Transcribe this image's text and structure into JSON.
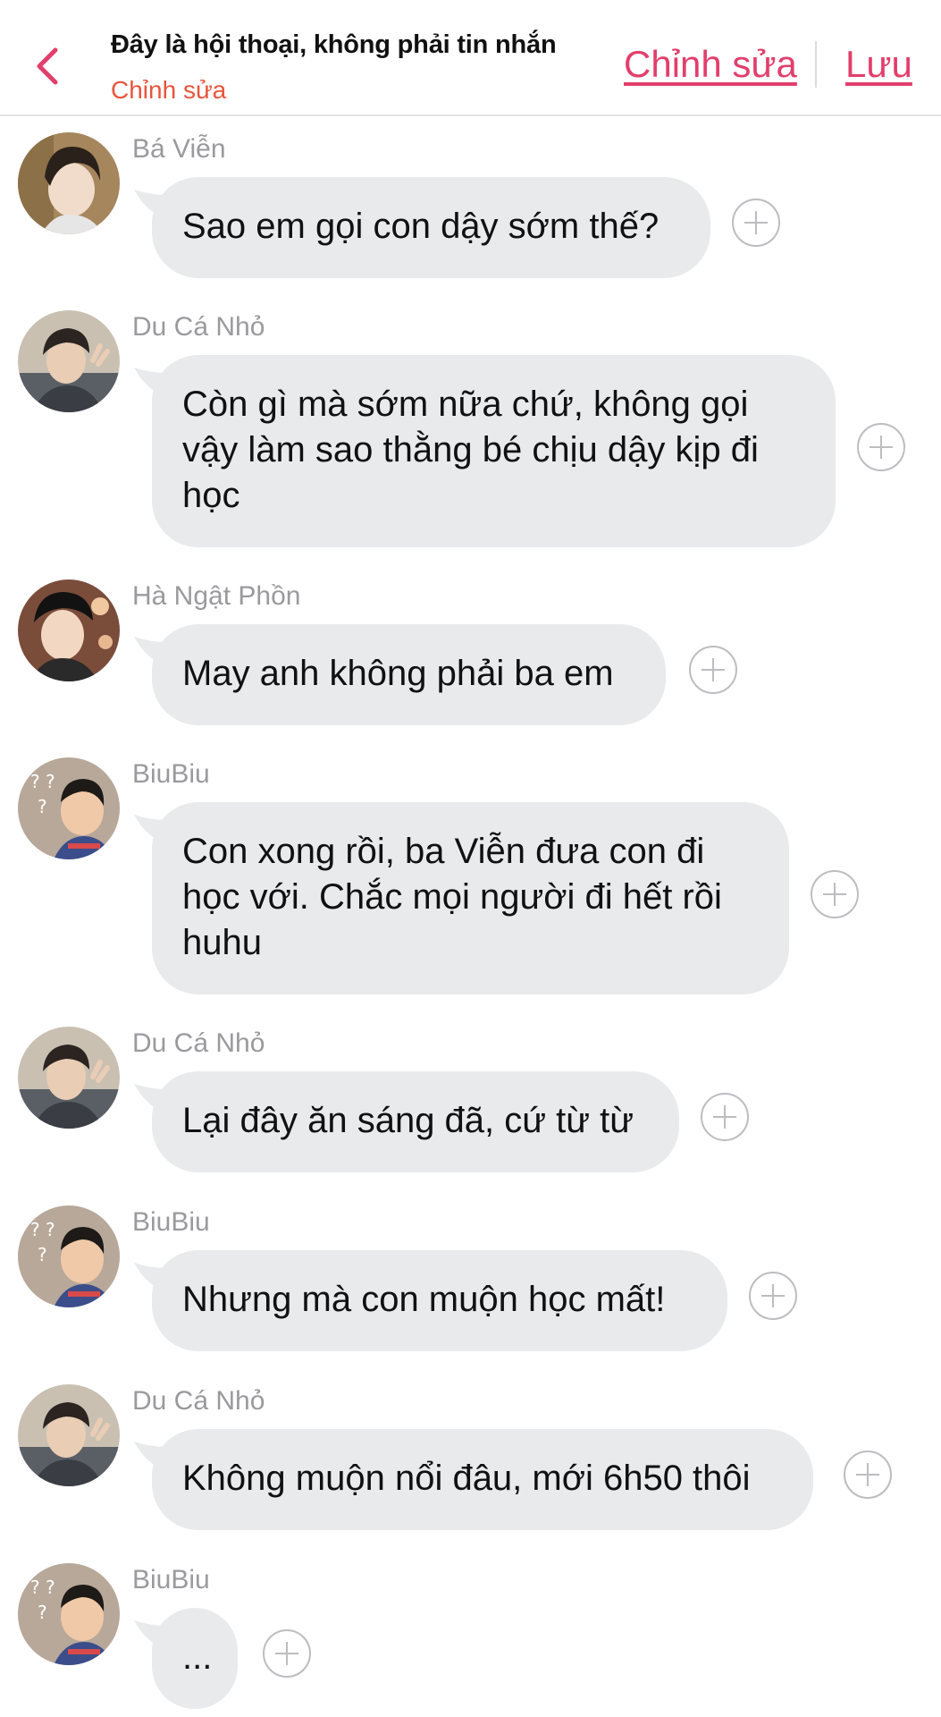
{
  "header": {
    "title": "Đây là hội thoại, không phải tin nhắn",
    "subtitle": "Chỉnh sửa",
    "edit_label": "Chỉnh sửa",
    "save_label": "Lưu",
    "accent_color": "#e23f6c"
  },
  "messages": [
    {
      "sender": "Bá Viễn",
      "text": "Sao em gọi con dậy sớm thế?"
    },
    {
      "sender": "Du Cá Nhỏ",
      "text": "Còn gì mà sớm nữa chứ, không gọi vậy làm sao thằng bé chịu dậy kịp đi học"
    },
    {
      "sender": "Hà Ngật Phồn",
      "text": "May anh không phải ba em"
    },
    {
      "sender": "BiuBiu",
      "text": "Con xong rồi, ba Viễn đưa con đi học với. Chắc mọi người đi hết rồi huhu"
    },
    {
      "sender": "Du Cá Nhỏ",
      "text": "Lại đây ăn sáng đã, cứ từ từ"
    },
    {
      "sender": "BiuBiu",
      "text": "Nhưng mà con muộn học mất!"
    },
    {
      "sender": "Du Cá Nhỏ",
      "text": "Không muộn nổi đâu, mới 6h50 thôi"
    },
    {
      "sender": "BiuBiu",
      "text": "..."
    }
  ]
}
